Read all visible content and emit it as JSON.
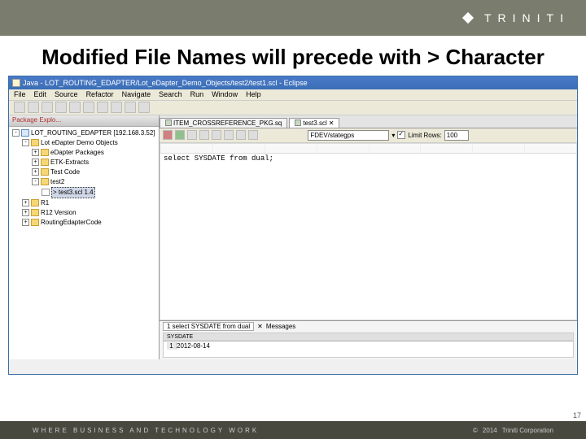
{
  "brand": "TRINITI",
  "slide": {
    "title": "Modified File Names will precede with > Character"
  },
  "window": {
    "title": "Java - LOT_ROUTING_EDAPTER/Lot_eDapter_Demo_Objects/test2/test1.scl - Eclipse"
  },
  "menu": [
    "File",
    "Edit",
    "Source",
    "Refactor",
    "Navigate",
    "Search",
    "Run",
    "Window",
    "Help"
  ],
  "explorer": {
    "tab": "Package Explo...",
    "project": "LOT_ROUTING_EDAPTER   [192.168.3.52]",
    "nodes": {
      "demoObjects": "Lot eDapter Demo Objects",
      "packages": "eDapter Packages",
      "etk": "ETK-Extracts",
      "testCode": "Test Code",
      "test2": "test2",
      "modifiedFile": "> test3.scl 1.4",
      "r1": "R1",
      "r12": "R12 Version",
      "routing": "RoutingEdapterCode"
    }
  },
  "editor": {
    "tab1": "ITEM_CROSSREFERENCE_PKG.sq",
    "tab2": "test3.scl",
    "conn": "FDEV/stategps",
    "limitLabel": "Limit Rows:",
    "limitValue": "100",
    "code": "select SYSDATE from dual;"
  },
  "results": {
    "tab1": "1 select SYSDATE from dual",
    "tab2": "Messages",
    "column": "SYSDATE",
    "value": "2012-08-14"
  },
  "footer": {
    "tagline": "WHERE BUSINESS AND TECHNOLOGY WORK",
    "year": "2014",
    "corp": "Triniti Corporation"
  },
  "pageNum": "17"
}
